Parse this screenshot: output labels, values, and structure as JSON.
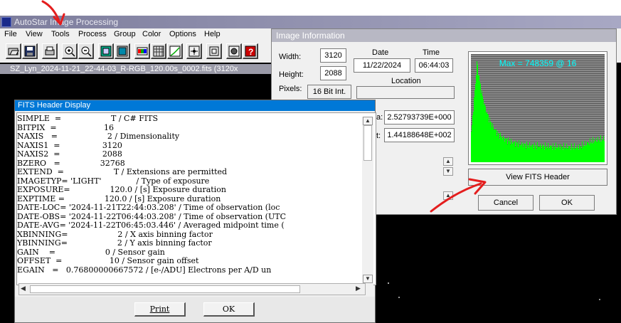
{
  "app": {
    "title": "AutoStar Image Processing",
    "menu": [
      "File",
      "View",
      "Tools",
      "Process",
      "Group",
      "Color",
      "Options",
      "Help"
    ],
    "image_window_title": "SZ_Lyn_2024-11-21_22-44-03_R-RGB_120.00s_0002.fits (3120x"
  },
  "info_dialog": {
    "title": "Image Information",
    "width_label": "Width:",
    "width_value": "3120",
    "height_label": "Height:",
    "height_value": "2088",
    "pixels_label": "Pixels:",
    "pixels_value": "16 Bit Int.",
    "date_label": "Date",
    "date_value": "11/22/2024",
    "time_label": "Time",
    "time_value": "06:44:03",
    "location_label": "Location",
    "location_value": "",
    "field1_label_partial": "a:",
    "field1_value": "2.52793739E+000",
    "field2_label_partial": "t:",
    "field2_value": "1.44188648E+002",
    "histogram_max_text": "Max = 748359 @ 16",
    "view_fits_header_button": "View FITS Header",
    "cancel_button": "Cancel",
    "ok_button": "OK",
    "histogram_color": "#00ff00",
    "histogram_label_color": "#00ffff"
  },
  "fits_dialog": {
    "title": "FITS Header Display",
    "lines": [
      "SIMPLE  =                    T / C# FITS",
      "BITPIX  =                   16",
      "NAXIS   =                    2 / Dimensionality",
      "NAXIS1  =                 3120",
      "NAXIS2  =                 2088",
      "BZERO   =                32768",
      "EXTEND  =                    T / Extensions are permitted",
      "IMAGETYP= 'LIGHT'              / Type of exposure",
      "EXPOSURE=                120.0 / [s] Exposure duration",
      "EXPTIME =                120.0 / [s] Exposure duration",
      "DATE-LOC= '2024-11-21T22:44:03.208' / Time of observation (loc",
      "DATE-OBS= '2024-11-22T06:44:03.208' / Time of observation (UTC",
      "DATE-AVG= '2024-11-22T06:45:03.446' / Averaged midpoint time (",
      "XBINNING=                    2 / X axis binning factor",
      "YBINNING=                    2 / Y axis binning factor",
      "GAIN    =                    0 / Sensor gain",
      "OFFSET  =                   10 / Sensor gain offset",
      "EGAIN   =   0.76800000667572 / [e-/ADU] Electrons per A/D un"
    ],
    "print_button": "Print",
    "ok_button": "OK"
  },
  "colors": {
    "annotation_red": "#e41e1e",
    "fits_titlebar": "#0078d7"
  }
}
